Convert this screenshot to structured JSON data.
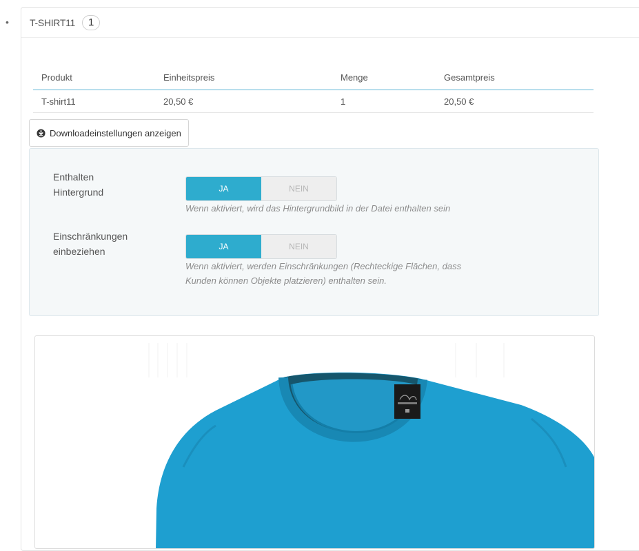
{
  "product": {
    "title": "T-SHIRT11",
    "count": "1"
  },
  "table": {
    "headers": [
      "Produkt",
      "Einheitspreis",
      "Menge",
      "Gesamtpreis"
    ],
    "rows": [
      [
        "T-shirt11",
        "20,50 €",
        "1",
        "20,50 €"
      ]
    ]
  },
  "download_button": {
    "label": "Downloadeinstellungen anzeigen",
    "icon": "download-circle-icon"
  },
  "settings": [
    {
      "label_line1": "Enthalten",
      "label_line2": "Hintergrund",
      "on": "JA",
      "off": "NEIN",
      "value": "JA",
      "help_line1": "Wenn aktiviert, wird das Hintergrundbild in der Datei enthalten sein",
      "help_line2": ""
    },
    {
      "label_line1": "Einschränkungen",
      "label_line2": "einbeziehen",
      "on": "JA",
      "off": "NEIN",
      "value": "JA",
      "help_line1": "Wenn aktiviert, werden Einschränkungen (Rechteckige Flächen, dass",
      "help_line2": "Kunden können Objekte platzieren) enthalten sein."
    }
  ],
  "colors": {
    "accent": "#2eacce",
    "shirt": "#1e9fd0",
    "label_tag": "#1a1a1a"
  }
}
